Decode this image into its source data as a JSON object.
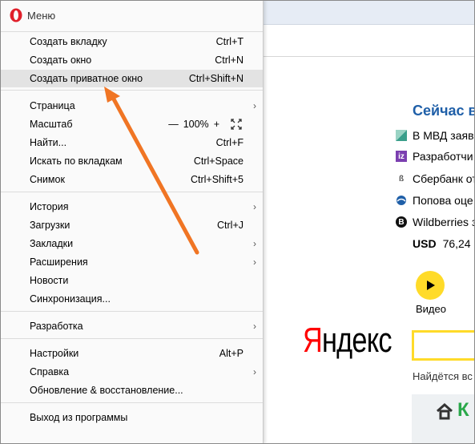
{
  "menu": {
    "title": "Меню",
    "items": [
      {
        "label": "Создать вкладку",
        "shortcut": "Ctrl+T"
      },
      {
        "label": "Создать окно",
        "shortcut": "Ctrl+N"
      },
      {
        "label": "Создать приватное окно",
        "shortcut": "Ctrl+Shift+N"
      },
      {
        "label": "Страница",
        "shortcut": ""
      },
      {
        "label": "Масштаб",
        "shortcut": ""
      },
      {
        "label": "Найти...",
        "shortcut": "Ctrl+F"
      },
      {
        "label": "Искать по вкладкам",
        "shortcut": "Ctrl+Space"
      },
      {
        "label": "Снимок",
        "shortcut": "Ctrl+Shift+5"
      },
      {
        "label": "История",
        "shortcut": ""
      },
      {
        "label": "Загрузки",
        "shortcut": "Ctrl+J"
      },
      {
        "label": "Закладки",
        "shortcut": ""
      },
      {
        "label": "Расширения",
        "shortcut": ""
      },
      {
        "label": "Новости",
        "shortcut": ""
      },
      {
        "label": "Синхронизация...",
        "shortcut": ""
      },
      {
        "label": "Разработка",
        "shortcut": ""
      },
      {
        "label": "Настройки",
        "shortcut": "Alt+P"
      },
      {
        "label": "Справка",
        "shortcut": ""
      },
      {
        "label": "Обновление & восстановление...",
        "shortcut": ""
      },
      {
        "label": "Выход из программы",
        "shortcut": ""
      }
    ],
    "zoom": {
      "minus": "—",
      "value": "100%",
      "plus": "+"
    }
  },
  "page": {
    "news_title": "Сейчас в",
    "news": [
      {
        "text": "В МВД заяв",
        "icon": "mvd-icon",
        "color": "#3a9f8b"
      },
      {
        "text": "Разработчи",
        "icon": "iz-icon",
        "color": "#7b3fb0"
      },
      {
        "text": "Сбербанк от",
        "icon": "sber-icon",
        "color": "#555555"
      },
      {
        "text": "Попова оце",
        "icon": "globe-icon",
        "color": "#1f5fa8"
      },
      {
        "text": "Wildberries з",
        "icon": "b-icon",
        "color": "#111111"
      }
    ],
    "usd_label": "USD",
    "usd_value": "76,24",
    "video_label": "Видео",
    "logo_first": "Я",
    "logo_rest": "ндекс",
    "found_text": "Найдётся вс",
    "card_letter": "К"
  },
  "colors": {
    "opera_red": "#e0202b",
    "arrow": "#f07524",
    "yandex_red": "#ff0000",
    "yandex_yellow": "#ffdb29"
  }
}
